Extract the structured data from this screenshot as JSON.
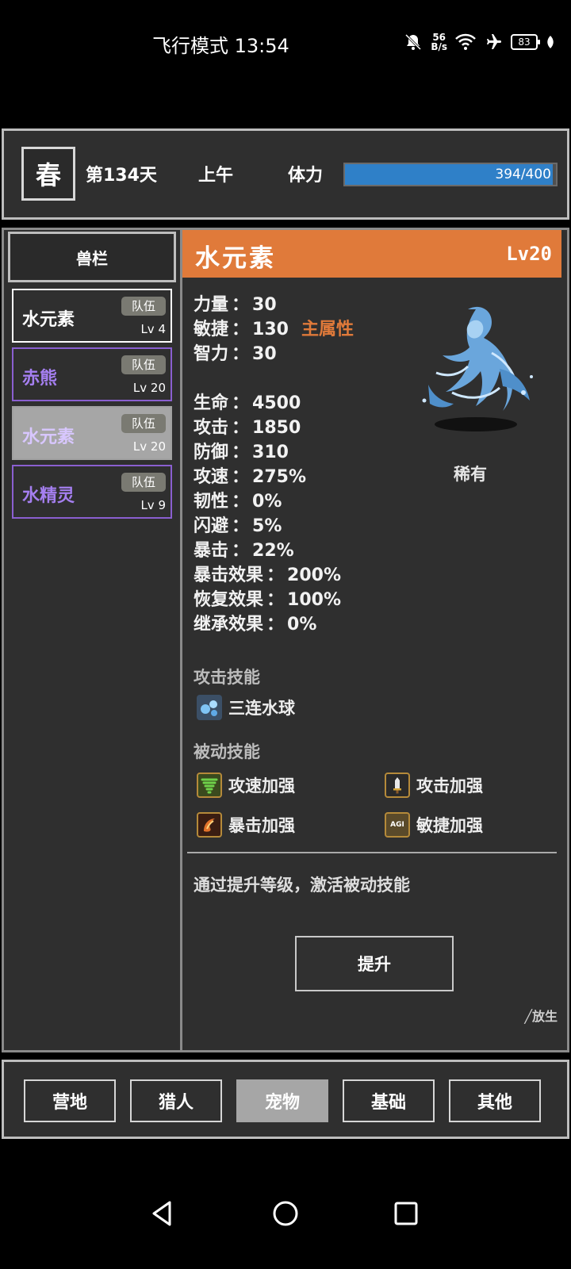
{
  "status_bar": {
    "time": "飞行模式 13:54",
    "net_speed_value": "56",
    "net_speed_unit": "B/s",
    "battery": "83"
  },
  "header": {
    "season": "春",
    "day": "第134天",
    "period": "上午",
    "stamina_label": "体力",
    "stamina_value": "394/400",
    "stamina_fraction": 0.985,
    "stamina_color": "#2f80c8"
  },
  "sidebar": {
    "title": "兽栏",
    "pets": [
      {
        "name": "水元素",
        "badge": "队伍",
        "level": "Lv 4"
      },
      {
        "name": "赤熊",
        "badge": "队伍",
        "level": "Lv 20"
      },
      {
        "name": "水元素",
        "badge": "队伍",
        "level": "Lv 20"
      },
      {
        "name": "水精灵",
        "badge": "队伍",
        "level": "Lv 9"
      }
    ]
  },
  "detail": {
    "name": "水元素",
    "level": "Lv20",
    "accent_color": "#e07a3a",
    "stats": [
      {
        "label": "力量",
        "value": "30"
      },
      {
        "label": "敏捷",
        "value": "130"
      },
      {
        "label": "智力",
        "value": "30"
      },
      {
        "label": "生命",
        "value": "4500"
      },
      {
        "label": "攻击",
        "value": "1850"
      },
      {
        "label": "防御",
        "value": "310"
      },
      {
        "label": "攻速",
        "value": "275%"
      },
      {
        "label": "韧性",
        "value": "0%"
      },
      {
        "label": "闪避",
        "value": "5%"
      },
      {
        "label": "暴击",
        "value": "22%"
      },
      {
        "label": "暴击效果",
        "value": "200%"
      },
      {
        "label": "恢复效果",
        "value": "100%"
      },
      {
        "label": "继承效果",
        "value": "0%"
      }
    ],
    "separator": "：",
    "main_attribute": "主属性",
    "rarity": "稀有",
    "attack_skill_title": "攻击技能",
    "attack_skills": [
      {
        "name": "三连水球",
        "icon": "water-orb-icon"
      }
    ],
    "passive_skill_title": "被动技能",
    "passive_skills": [
      {
        "name": "攻速加强",
        "icon": "tornado-icon"
      },
      {
        "name": "攻击加强",
        "icon": "sword-icon"
      },
      {
        "name": "暴击加强",
        "icon": "crit-icon"
      },
      {
        "name": "敏捷加强",
        "icon": "agi-icon",
        "icon_text": "AGI"
      }
    ],
    "hint": "通过提升等级，激活被动技能",
    "upgrade_label": "提升",
    "release_label": "╱放生"
  },
  "bottom_nav": {
    "items": [
      "营地",
      "猎人",
      "宠物",
      "基础",
      "其他"
    ],
    "active": "宠物"
  }
}
